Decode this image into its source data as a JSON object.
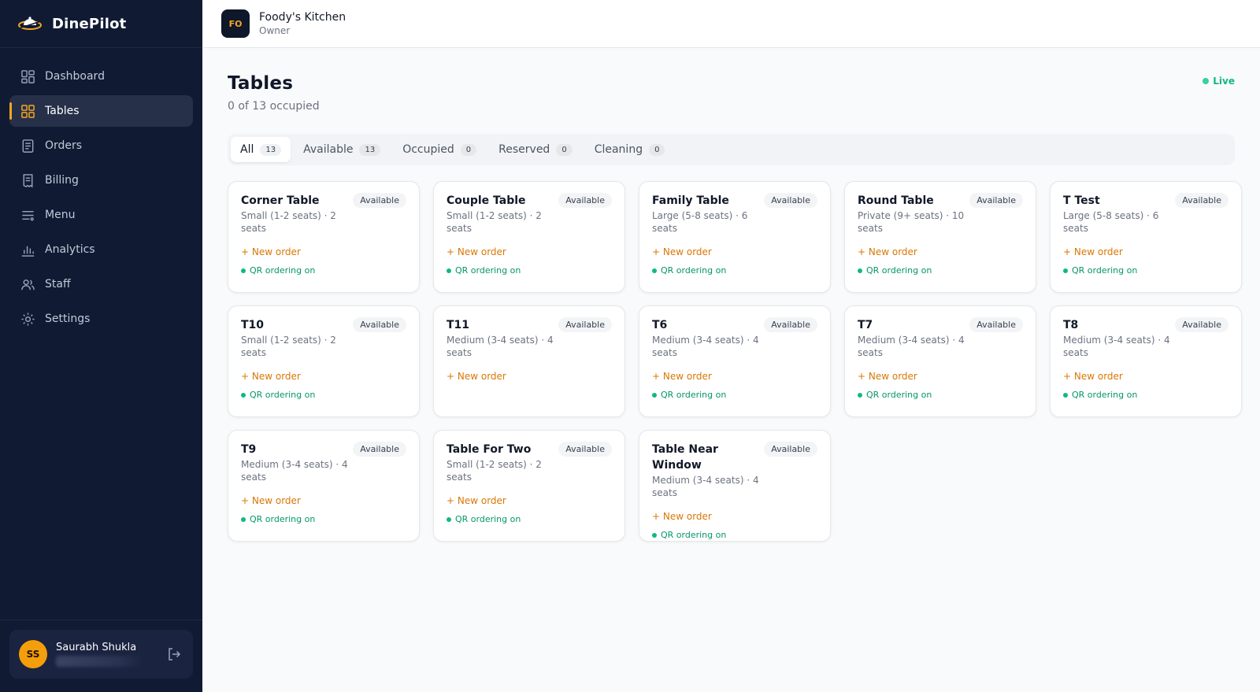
{
  "app": {
    "name": "DinePilot"
  },
  "sidebar": {
    "items": [
      {
        "label": "Dashboard",
        "icon": "dashboard-icon"
      },
      {
        "label": "Tables",
        "icon": "tables-icon",
        "active": true
      },
      {
        "label": "Orders",
        "icon": "orders-icon"
      },
      {
        "label": "Billing",
        "icon": "billing-icon"
      },
      {
        "label": "Menu",
        "icon": "menu-icon"
      },
      {
        "label": "Analytics",
        "icon": "analytics-icon"
      },
      {
        "label": "Staff",
        "icon": "staff-icon"
      },
      {
        "label": "Settings",
        "icon": "settings-icon"
      }
    ],
    "user": {
      "initials": "SS",
      "name": "Saurabh Shukla"
    }
  },
  "topbar": {
    "org_initials": "FO",
    "org_name": "Foody's Kitchen",
    "org_role": "Owner"
  },
  "page": {
    "title": "Tables",
    "subtitle": "0 of 13 occupied",
    "live_label": "Live"
  },
  "tabs": [
    {
      "label": "All",
      "count": "13",
      "active": true
    },
    {
      "label": "Available",
      "count": "13"
    },
    {
      "label": "Occupied",
      "count": "0"
    },
    {
      "label": "Reserved",
      "count": "0"
    },
    {
      "label": "Cleaning",
      "count": "0"
    }
  ],
  "tables": [
    {
      "name": "Corner Table",
      "status": "Available",
      "details": "Small (1-2 seats) · 2 seats",
      "action": "+ New order",
      "qr": "QR ordering on"
    },
    {
      "name": "Couple Table",
      "status": "Available",
      "details": "Small (1-2 seats) · 2 seats",
      "action": "+ New order",
      "qr": "QR ordering on"
    },
    {
      "name": "Family Table",
      "status": "Available",
      "details": "Large (5-8 seats) · 6 seats",
      "action": "+ New order",
      "qr": "QR ordering on"
    },
    {
      "name": "Round Table",
      "status": "Available",
      "details": "Private (9+ seats) · 10 seats",
      "action": "+ New order",
      "qr": "QR ordering on"
    },
    {
      "name": "T Test",
      "status": "Available",
      "details": "Large (5-8 seats) · 6 seats",
      "action": "+ New order",
      "qr": "QR ordering on"
    },
    {
      "name": "T10",
      "status": "Available",
      "details": "Small (1-2 seats) · 2 seats",
      "action": "+ New order",
      "qr": "QR ordering on"
    },
    {
      "name": "T11",
      "status": "Available",
      "details": "Medium (3-4 seats) · 4 seats",
      "action": "+ New order",
      "qr": ""
    },
    {
      "name": "T6",
      "status": "Available",
      "details": "Medium (3-4 seats) · 4 seats",
      "action": "+ New order",
      "qr": "QR ordering on"
    },
    {
      "name": "T7",
      "status": "Available",
      "details": "Medium (3-4 seats) · 4 seats",
      "action": "+ New order",
      "qr": "QR ordering on"
    },
    {
      "name": "T8",
      "status": "Available",
      "details": "Medium (3-4 seats) · 4 seats",
      "action": "+ New order",
      "qr": "QR ordering on"
    },
    {
      "name": "T9",
      "status": "Available",
      "details": "Medium (3-4 seats) · 4 seats",
      "action": "+ New order",
      "qr": "QR ordering on"
    },
    {
      "name": "Table For Two",
      "status": "Available",
      "details": "Small (1-2 seats) · 2 seats",
      "action": "+ New order",
      "qr": "QR ordering on"
    },
    {
      "name": "Table Near Window",
      "status": "Available",
      "details": "Medium (3-4 seats) · 4 seats",
      "action": "+ New order",
      "qr": "QR ordering on"
    }
  ],
  "colors": {
    "sidebar_bg": "#101a33",
    "accent": "#f5a524",
    "new_order": "#d97706",
    "qr_on": "#059669"
  }
}
